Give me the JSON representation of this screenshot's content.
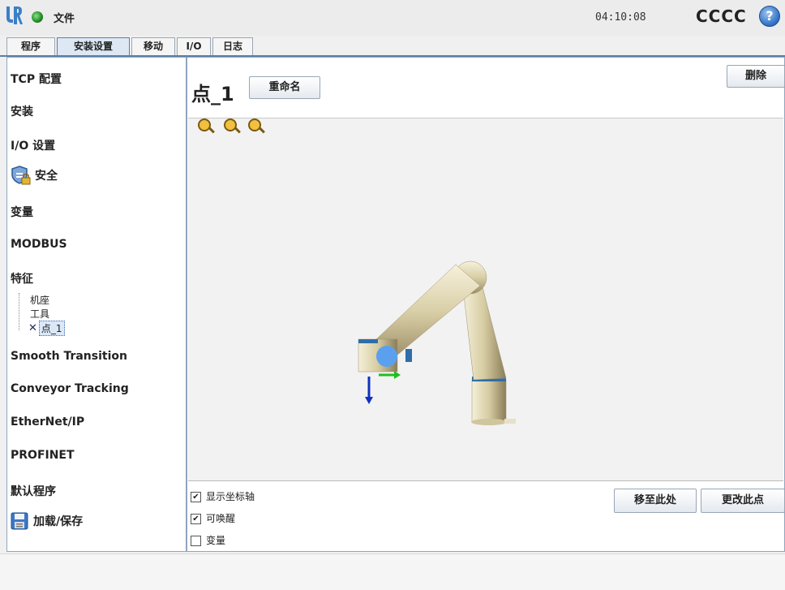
{
  "header": {
    "file_menu": "文件",
    "clock": "04:10:08",
    "robot_name": "CCCC",
    "help_symbol": "?"
  },
  "tabs": [
    {
      "label": "程序",
      "active": false
    },
    {
      "label": "安装设置",
      "active": true
    },
    {
      "label": "移动",
      "active": false
    },
    {
      "label": "I/O",
      "active": false
    },
    {
      "label": "日志",
      "active": false
    }
  ],
  "sidebar": {
    "items": [
      {
        "label": "TCP 配置"
      },
      {
        "label": "安装"
      },
      {
        "label": "I/O 设置"
      },
      {
        "label": "安全",
        "icon": "shield-lock-icon"
      },
      {
        "label": "变量"
      },
      {
        "label": "MODBUS"
      },
      {
        "label": "特征"
      },
      {
        "label": "Smooth Transition"
      },
      {
        "label": "Conveyor Tracking"
      },
      {
        "label": "EtherNet/IP"
      },
      {
        "label": "PROFINET"
      },
      {
        "label": "默认程序"
      },
      {
        "label": "加载/保存",
        "icon": "save-disk-icon"
      }
    ],
    "features": [
      {
        "label": "机座"
      },
      {
        "label": "工具"
      },
      {
        "label": "点_1",
        "selected": true
      }
    ]
  },
  "main": {
    "title": "点_1",
    "rename_label": "重命名",
    "delete_label": "删除",
    "zoom_icons": [
      "zoom-in-icon",
      "zoom-fit-icon",
      "zoom-out-icon"
    ],
    "checkboxes": [
      {
        "label": "显示坐标轴",
        "checked": true,
        "mark": "✔"
      },
      {
        "label": "可唤醒",
        "checked": true,
        "mark": "✔"
      },
      {
        "label": "变量",
        "checked": false,
        "mark": ""
      }
    ],
    "move_here_label": "移至此处",
    "change_point_label": "更改此点"
  },
  "colors": {
    "accent": "#5b7fa8",
    "robot_body": "#d8cfa8",
    "robot_joint_ring": "#2f6ea8",
    "axis_x": "#1fbf1f",
    "axis_z": "#1030c0",
    "point_marker": "#5aa0ee"
  }
}
